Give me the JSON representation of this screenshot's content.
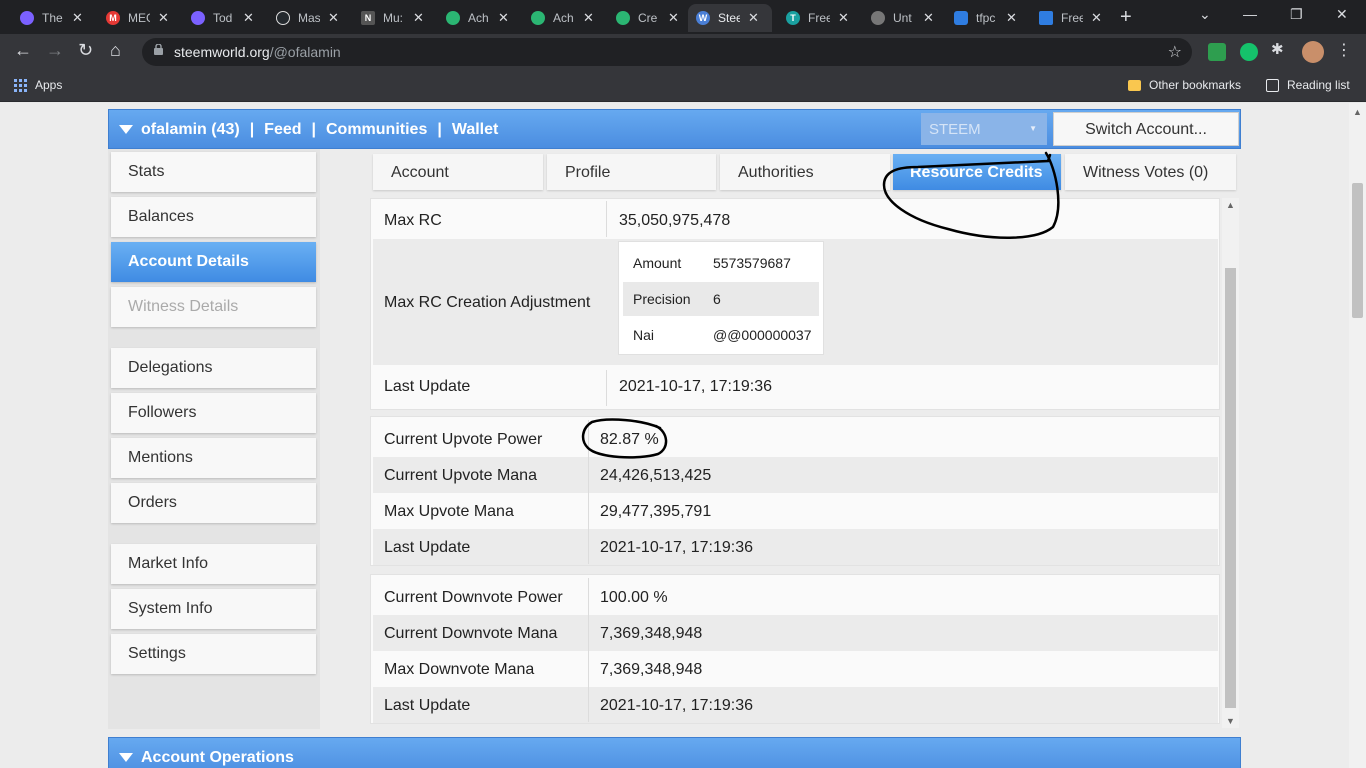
{
  "browser": {
    "tabs": [
      {
        "label": "The",
        "color": "#7b61ff"
      },
      {
        "label": "MEG",
        "color": "#e53935"
      },
      {
        "label": "Tod",
        "color": "#7b61ff"
      },
      {
        "label": "Mas",
        "color": "#24292e"
      },
      {
        "label": "Mu:",
        "color": "#555555"
      },
      {
        "label": "Ach",
        "color": "#2bb673"
      },
      {
        "label": "Ach",
        "color": "#2bb673"
      },
      {
        "label": "Cre",
        "color": "#2bb673"
      },
      {
        "label": "Stee",
        "color": "#4a7fd6",
        "active": true
      },
      {
        "label": "Free",
        "color": "#1aa0a0"
      },
      {
        "label": "Unt",
        "color": "#777777"
      },
      {
        "label": "tfpc",
        "color": "#2f7de1"
      },
      {
        "label": "Free",
        "color": "#2f7de1"
      }
    ],
    "url_domain": "steemworld.org",
    "url_path": "/@ofalamin",
    "bookmarks": {
      "apps": "Apps",
      "other": "Other bookmarks",
      "reading": "Reading list"
    }
  },
  "topnav": {
    "user": "ofalamin (43)",
    "feed": "Feed",
    "communities": "Communities",
    "wallet": "Wallet",
    "sep": "|",
    "chain_select": "STEEM",
    "switch_account": "Switch Account..."
  },
  "sidebar": {
    "items": [
      "Stats",
      "Balances",
      "Account Details",
      "Witness Details",
      "Delegations",
      "Followers",
      "Mentions",
      "Orders",
      "Market Info",
      "System Info",
      "Settings"
    ]
  },
  "tabs": [
    "Account",
    "Profile",
    "Authorities",
    "Resource Credits",
    "Witness Votes (0)"
  ],
  "rc": {
    "max_rc_label": "Max RC",
    "max_rc": "35,050,975,478",
    "adjust_label": "Max RC Creation Adjustment",
    "adjust": {
      "amount_label": "Amount",
      "amount": "5573579687",
      "precision_label": "Precision",
      "precision": "6",
      "nai_label": "Nai",
      "nai": "@@000000037"
    },
    "last_update_label": "Last Update",
    "last_update": "2021-10-17, 17:19:36"
  },
  "upvote": {
    "power_label": "Current Upvote Power",
    "power": "82.87 %",
    "mana_label": "Current Upvote Mana",
    "mana": "24,426,513,425",
    "max_label": "Max Upvote Mana",
    "max": "29,477,395,791",
    "last_update_label": "Last Update",
    "last_update": "2021-10-17, 17:19:36"
  },
  "downvote": {
    "power_label": "Current Downvote Power",
    "power": "100.00 %",
    "mana_label": "Current Downvote Mana",
    "mana": "7,369,348,948",
    "max_label": "Max Downvote Mana",
    "max": "7,369,348,948",
    "last_update_label": "Last Update",
    "last_update": "2021-10-17, 17:19:36"
  },
  "bottom": {
    "title": "Account Operations"
  }
}
